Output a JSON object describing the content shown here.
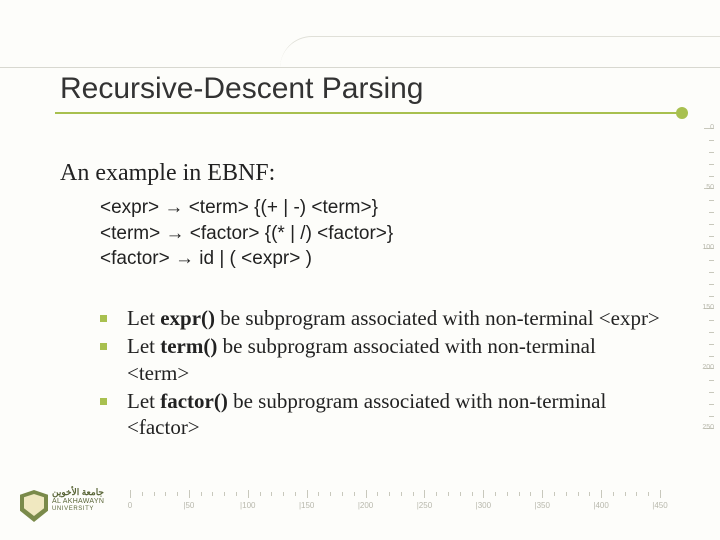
{
  "title": "Recursive-Descent Parsing",
  "subtitle": "An example in EBNF:",
  "grammar": {
    "line1": "<expr> → <term> {(+ | -) <term>}",
    "line2": "<term> → <factor> {(* | /) <factor>}",
    "line3": "<factor> → id | ( <expr> )"
  },
  "bullets": [
    {
      "pre": "Let ",
      "fn": "expr()",
      "post": " be subprogram associated with non-terminal <expr>"
    },
    {
      "pre": "Let ",
      "fn": "term()",
      "post": " be subprogram associated with non-terminal <term>"
    },
    {
      "pre": "Let ",
      "fn": "factor()",
      "post": " be subprogram associated with non-terminal <factor>"
    }
  ],
  "bottom_ruler": [
    "0",
    "|50",
    "|100",
    "|150",
    "|200",
    "|250",
    "|300",
    "|350",
    "|400",
    "|450"
  ],
  "right_ruler": [
    "0",
    "50",
    "100",
    "150",
    "200",
    "250"
  ],
  "logo": {
    "ar": "جامعة الأخوين",
    "en": "AL AKHAWAYN",
    "sub": "UNIVERSITY"
  }
}
